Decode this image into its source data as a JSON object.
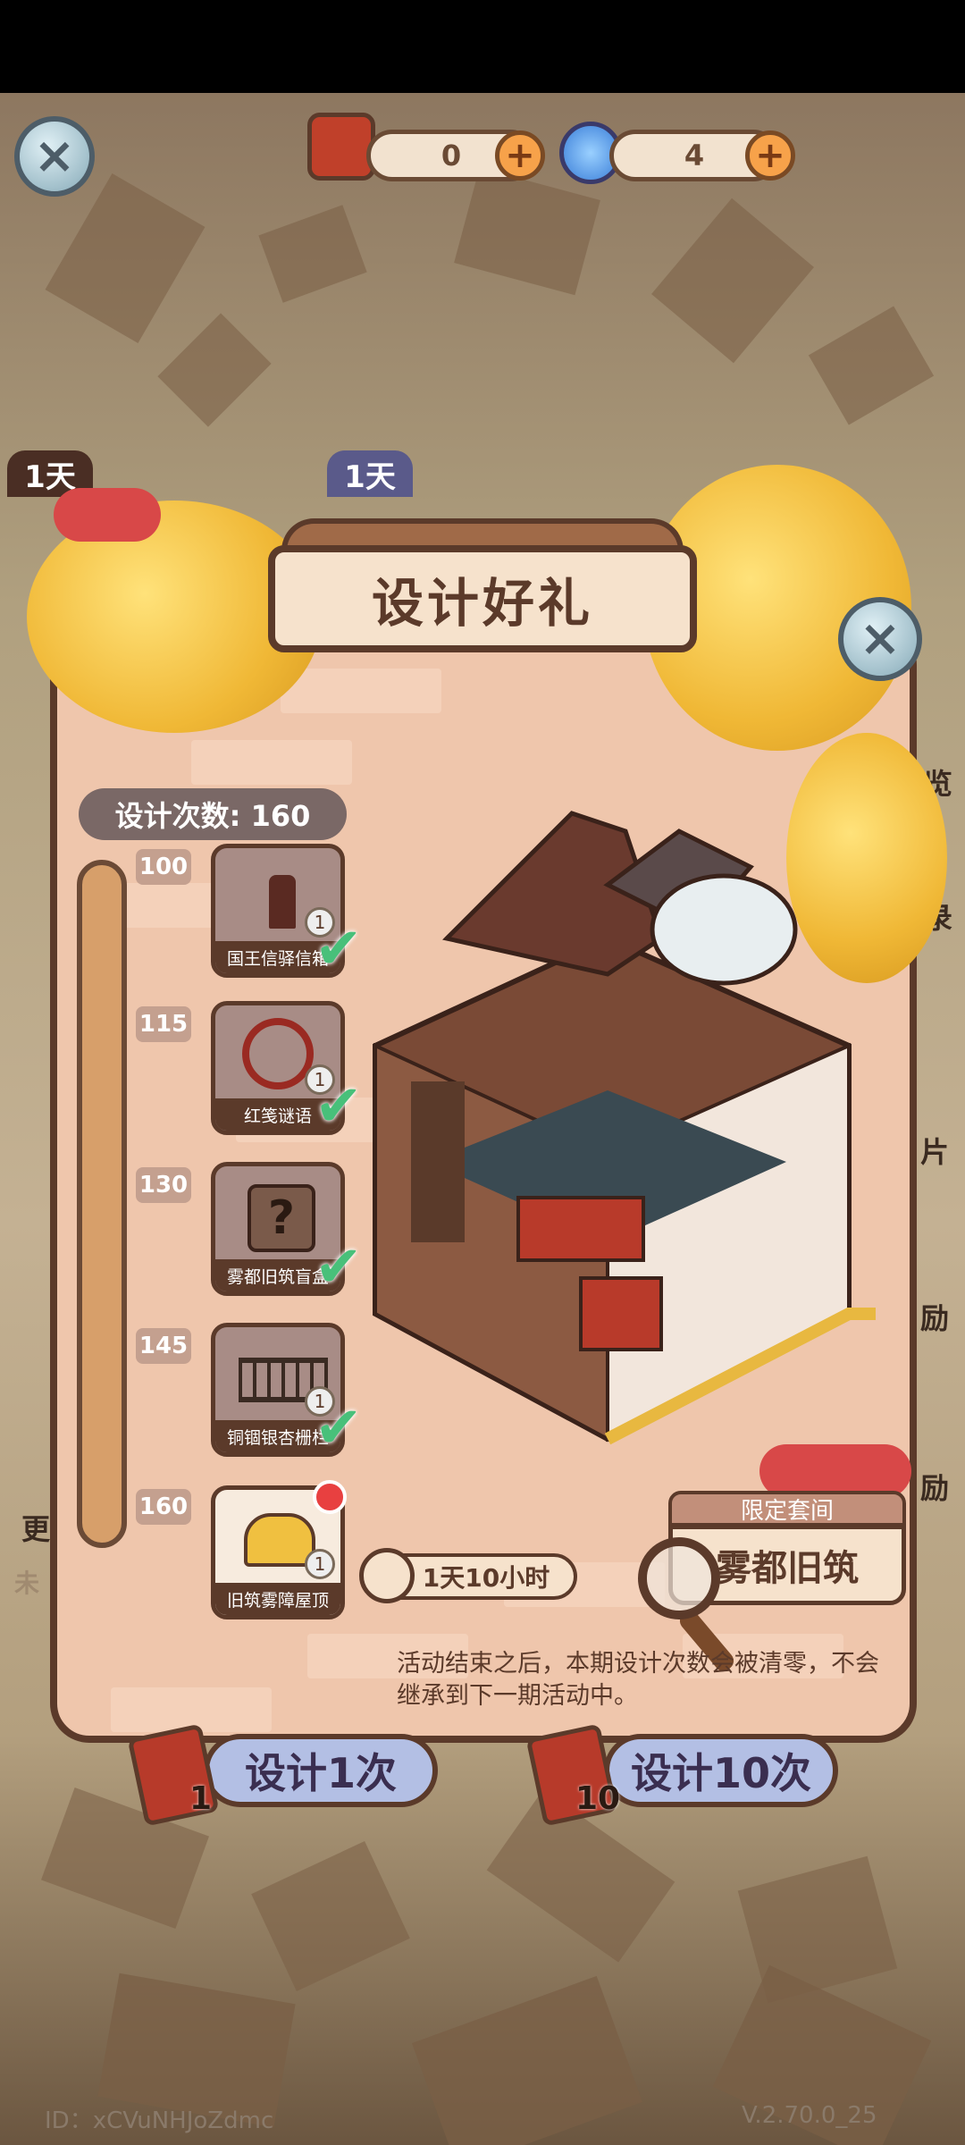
{
  "top_bar": {
    "tickets": "0",
    "swirl": "4"
  },
  "background_tabs": {
    "left_tab": "1天",
    "mid_tab": "1天",
    "side_labels": [
      "览",
      "录",
      "片",
      "励",
      "励"
    ],
    "left_side_label": "更",
    "left_side_faded": "未"
  },
  "panel": {
    "title": "设计好礼",
    "design_count": "设计次数: 160",
    "tiers": [
      {
        "value": "100",
        "name": "国王信驿信箱",
        "count": "1",
        "claimed": true
      },
      {
        "value": "115",
        "name": "红笺谜语",
        "count": "1",
        "claimed": true
      },
      {
        "value": "130",
        "name": "雾都旧筑盲盒",
        "count": "",
        "claimed": true
      },
      {
        "value": "145",
        "name": "铜锢银杏栅栏",
        "count": "1",
        "claimed": true
      },
      {
        "value": "160",
        "name": "旧筑雾障屋顶",
        "count": "1",
        "claimed": false
      }
    ],
    "timer": "1天10小时",
    "set_label": "限定套间",
    "set_name": "雾都旧筑",
    "notice": "活动结束之后，本期设计次数会被清零，不会继承到下一期活动中。"
  },
  "buttons": {
    "design_once": "设计1次",
    "design_once_cost": "1",
    "design_ten": "设计10次",
    "design_ten_cost": "10"
  },
  "footer": {
    "id": "ID：xCVuNHJoZdmc",
    "version": "V.2.70.0_25"
  },
  "colors": {
    "panel_bg": "#efc6ac",
    "frame": "#5b3a2a",
    "check_green": "#48c07a",
    "button_blue": "#b3bfe4"
  }
}
